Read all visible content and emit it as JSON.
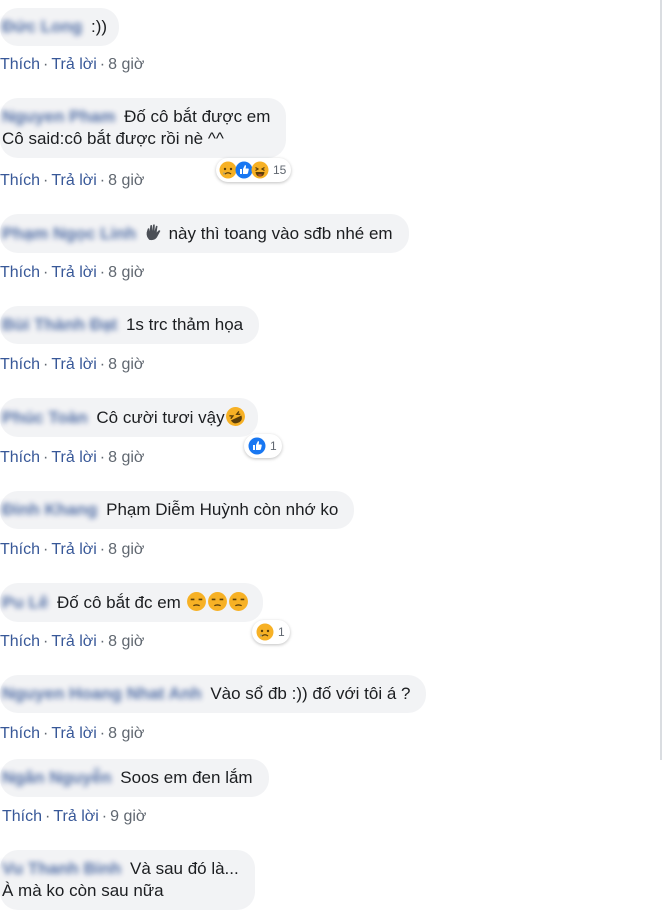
{
  "actions": {
    "like": "Thích",
    "reply": "Trả lời",
    "separator": "·"
  },
  "comments": [
    {
      "author": "Đức Long",
      "text": ":))",
      "time": "8 giờ"
    },
    {
      "author": "Nguyen Pham",
      "text": "Đố cô bắt được em",
      "text2": "Cô said:cô bắt được rồi nè ^^",
      "time": "8 giờ",
      "reactions": {
        "icons": [
          "sad-icon",
          "like-icon",
          "haha-icon"
        ],
        "count": "15"
      }
    },
    {
      "author": "Phạm Ngọc Linh",
      "text": "này thì toang vào sđb nhé em",
      "time": "8 giờ"
    },
    {
      "author": "Bùi Thành Đạt",
      "text": "1s trc thảm họa",
      "time": "8 giờ"
    },
    {
      "author": "Phúc Toàn",
      "text": "Cô cười tươi vậy",
      "time": "8 giờ",
      "reactions": {
        "icons": [
          "like-icon"
        ],
        "count": "1"
      }
    },
    {
      "author": "Đinh Khang",
      "text": "Phạm Diễm Huỳnh còn nhớ ko",
      "time": "8 giờ"
    },
    {
      "author": "Pu Lê",
      "text": "Đố cô bắt đc em",
      "time": "8 giờ",
      "reactions": {
        "icons": [
          "sad-icon"
        ],
        "count": "1"
      }
    },
    {
      "author": "Nguyen Hoang Nhat Anh",
      "text": "Vào sổ đb :)) đố với tôi á ?",
      "time": "8 giờ"
    },
    {
      "author": "Ngân Nguyễn",
      "text": "Soos em đen lắm",
      "time": "9 giờ"
    },
    {
      "author": "Vu Thanh Binh",
      "text": "Và sau đó là...",
      "text2": "À mà ko còn sau nữa"
    }
  ],
  "colors": {
    "link": "#385898",
    "bubble": "#f2f3f5",
    "like_blue": "#1877f2",
    "emoji_yellow": "#f7b125"
  }
}
